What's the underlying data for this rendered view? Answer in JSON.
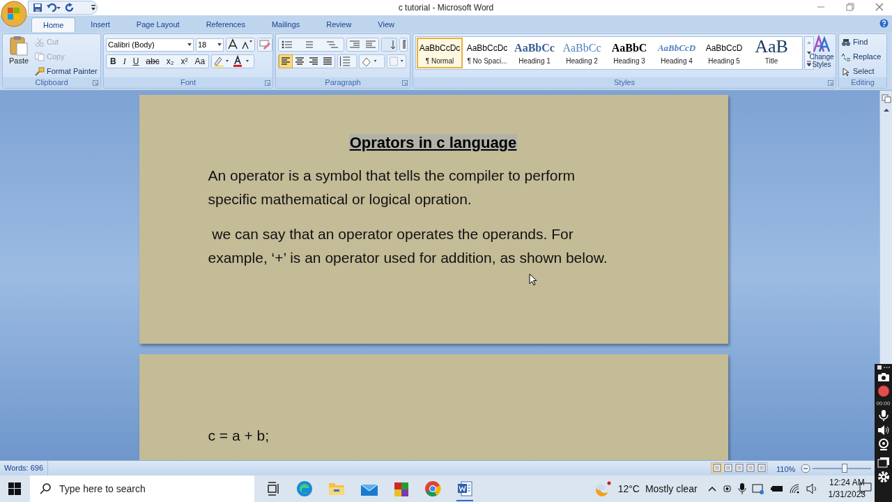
{
  "window": {
    "title": "c tutorial - Microsoft Word"
  },
  "tabs": [
    {
      "label": "Home",
      "selected": true
    },
    {
      "label": "Insert",
      "selected": false
    },
    {
      "label": "Page Layout",
      "selected": false
    },
    {
      "label": "References",
      "selected": false
    },
    {
      "label": "Mailings",
      "selected": false
    },
    {
      "label": "Review",
      "selected": false
    },
    {
      "label": "View",
      "selected": false
    }
  ],
  "clipboard": {
    "label": "Clipboard",
    "paste": "Paste",
    "items": [
      {
        "label": "Cut",
        "disabled": true
      },
      {
        "label": "Copy",
        "disabled": true
      },
      {
        "label": "Format Painter",
        "disabled": false
      }
    ]
  },
  "font": {
    "label": "Font",
    "font_name": "Calibri (Body)",
    "font_size": "18",
    "format_buttons": [
      "B",
      "I",
      "U",
      "abc",
      "x₂",
      "x²",
      "Aa"
    ]
  },
  "paragraph": {
    "label": "Paragraph",
    "alignments": [
      {
        "selected": true
      },
      {
        "selected": false
      },
      {
        "selected": false
      },
      {
        "selected": false
      }
    ]
  },
  "styles": {
    "label": "Styles",
    "items": [
      {
        "preview": "AaBbCcDc",
        "name": "¶ Normal",
        "kind": "normal",
        "selected": true
      },
      {
        "preview": "AaBbCcDc",
        "name": "¶ No Spaci...",
        "kind": "normal",
        "selected": false
      },
      {
        "preview": "AaBbCc",
        "name": "Heading 1",
        "kind": "h1",
        "selected": false
      },
      {
        "preview": "AaBbCc",
        "name": "Heading 2",
        "kind": "h2",
        "selected": false
      },
      {
        "preview": "AaBbC",
        "name": "Heading 3",
        "kind": "h3",
        "selected": false
      },
      {
        "preview": "AaBbCcD",
        "name": "Heading 4",
        "kind": "h4",
        "selected": false
      },
      {
        "preview": "AaBbCcD",
        "name": "Heading 5",
        "kind": "normal",
        "selected": false
      },
      {
        "preview": "AaB",
        "name": "Title",
        "kind": "title",
        "selected": false
      }
    ],
    "change_styles": "Change Styles"
  },
  "editing": {
    "label": "Editing",
    "items": [
      "Find",
      "Replace",
      "Select"
    ]
  },
  "pages": [
    {
      "heading": "Oprators in c language",
      "paragraphs": [
        "An operator is a symbol that tells the compiler to perform specific mathematical or logical opration.",
        " we can say that an operator operates the operands. For example, ‘+’ is an operator used for addition, as shown below."
      ]
    },
    {
      "paragraphs": [
        "c = a + b;"
      ]
    }
  ],
  "status_bar": {
    "words": "Words: 696",
    "view_buttons": [
      {
        "selected": true
      },
      {
        "selected": false
      },
      {
        "selected": false
      },
      {
        "selected": false
      },
      {
        "selected": false
      }
    ],
    "zoom": "110%",
    "zoom_slider": {
      "level": 0.55
    }
  },
  "recorder": {
    "timer": "00:00"
  },
  "taskbar": {
    "search_placeholder": "Type here to search",
    "temperature": "12°C",
    "weather": "Mostly clear",
    "time": "12:24 AM",
    "date": "1/31/2023"
  }
}
